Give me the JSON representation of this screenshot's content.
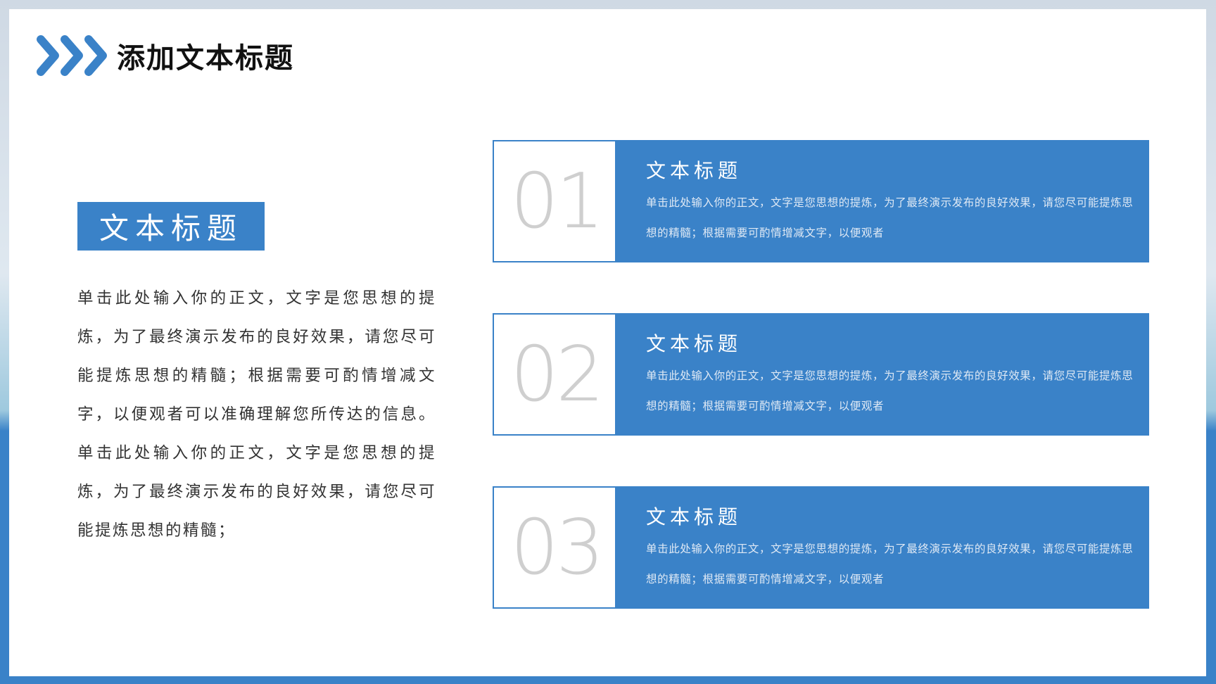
{
  "slide": {
    "title": "添加文本标题",
    "accent_color": "#3a82c8",
    "icon": "triple-chevron-right-icon"
  },
  "left": {
    "label": "文本标题",
    "body": "单击此处输入你的正文，文字是您思想的提炼，为了最终演示发布的良好效果，请您尽可能提炼思想的精髓；根据需要可酌情增减文字，以便观者可以准确理解您所传达的信息。单击此处输入你的正文，文字是您思想的提炼，为了最终演示发布的良好效果，请您尽可能提炼思想的精髓；"
  },
  "cards": [
    {
      "number": "01",
      "title": "文本标题",
      "text": "单击此处输入你的正文，文字是您思想的提炼，为了最终演示发布的良好效果，请您尽可能提炼思想的精髓；根据需要可酌情增减文字，以便观者"
    },
    {
      "number": "02",
      "title": "文本标题",
      "text": "单击此处输入你的正文，文字是您思想的提炼，为了最终演示发布的良好效果，请您尽可能提炼思想的精髓；根据需要可酌情增减文字，以便观者"
    },
    {
      "number": "03",
      "title": "文本标题",
      "text": "单击此处输入你的正文，文字是您思想的提炼，为了最终演示发布的良好效果，请您尽可能提炼思想的精髓；根据需要可酌情增减文字，以便观者"
    }
  ]
}
